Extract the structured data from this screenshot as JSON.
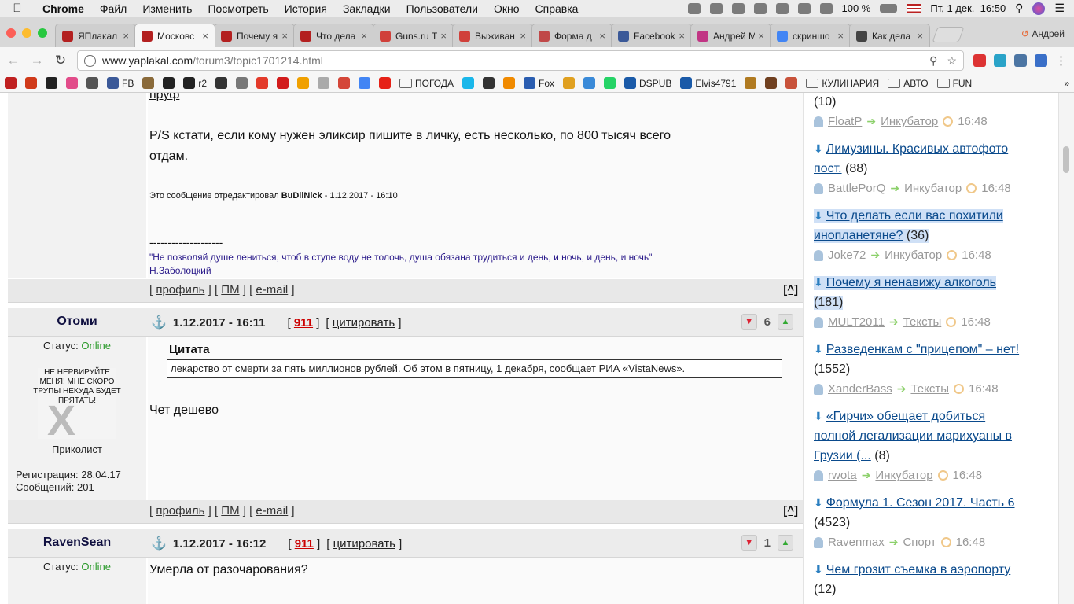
{
  "menubar": {
    "app": "Chrome",
    "items": [
      "Файл",
      "Изменить",
      "Посмотреть",
      "История",
      "Закладки",
      "Пользователи",
      "Окно",
      "Справка"
    ],
    "battery": "100 %",
    "datetime": "Пт, 1 дек.  16:50"
  },
  "tabs": [
    {
      "label": "ЯПлакал",
      "color": "#b32020"
    },
    {
      "label": "Московс",
      "color": "#b32020"
    },
    {
      "label": "Почему я",
      "color": "#b32020"
    },
    {
      "label": "Что дела",
      "color": "#b32020"
    },
    {
      "label": "Guns.ru Т",
      "color": "#d0403a"
    },
    {
      "label": "Выживан",
      "color": "#d0403a"
    },
    {
      "label": "Форма д",
      "color": "#c04848"
    },
    {
      "label": "Facebook",
      "color": "#3b5998"
    },
    {
      "label": "Андрей М",
      "color": "#c13584"
    },
    {
      "label": "скриншо",
      "color": "#4285f4"
    },
    {
      "label": "Как дела",
      "color": "#444444"
    }
  ],
  "active_tab_index": 1,
  "profile_name": "Андрей",
  "url": {
    "host": "www.yaplakal.com",
    "path": "/forum3/topic1701214.html"
  },
  "bookmarks": [
    {
      "label": "",
      "color": "#c02020"
    },
    {
      "label": "",
      "color": "#d03a1a"
    },
    {
      "label": "",
      "color": "#222222"
    },
    {
      "label": "",
      "color": "#e24c8a"
    },
    {
      "label": "",
      "color": "#555555"
    },
    {
      "label": "FB",
      "color": "#3b5998"
    },
    {
      "label": "",
      "color": "#8a6a3a"
    },
    {
      "label": "",
      "color": "#222222"
    },
    {
      "label": "r2",
      "color": "#222222"
    },
    {
      "label": "",
      "color": "#333333"
    },
    {
      "label": "",
      "color": "#777777"
    },
    {
      "label": "",
      "color": "#e33a2a"
    },
    {
      "label": "",
      "color": "#d21b1b"
    },
    {
      "label": "",
      "color": "#f0a000"
    },
    {
      "label": "",
      "color": "#aaaaaa"
    },
    {
      "label": "",
      "color": "#d44638"
    },
    {
      "label": "",
      "color": "#4285f4"
    },
    {
      "label": "",
      "color": "#e62117"
    },
    {
      "label": "ПОГОДА",
      "folder": true
    },
    {
      "label": "",
      "color": "#1ab7ea"
    },
    {
      "label": "",
      "color": "#333333"
    },
    {
      "label": "",
      "color": "#f08a00"
    },
    {
      "label": "Fox",
      "color": "#2a5db0"
    },
    {
      "label": "",
      "color": "#e0a020"
    },
    {
      "label": "",
      "color": "#3a8ad8"
    },
    {
      "label": "",
      "color": "#25d366"
    },
    {
      "label": "DSPUB",
      "color": "#1a5aa8"
    },
    {
      "label": "Elvis4791",
      "color": "#1a5aa8"
    },
    {
      "label": "",
      "color": "#b07a20"
    },
    {
      "label": "",
      "color": "#704020"
    },
    {
      "label": "",
      "color": "#c8523a"
    },
    {
      "label": "КУЛИНАРИЯ",
      "folder": true
    },
    {
      "label": "АВТО",
      "folder": true
    },
    {
      "label": "FUN",
      "folder": true
    }
  ],
  "prev_post": {
    "top_fragment": "пруф",
    "text_line1": "P/S кстати, если кому нужен эликсир пишите в личку, есть несколько, по 800 тысяч всего",
    "text_line2": "отдам.",
    "edited_prefix": "Это сообщение отредактировал ",
    "edited_user": "BuDilNick",
    "edited_suffix": " - 1.12.2017 - 16:10",
    "sig_rule": "--------------------",
    "sig_quote": "\"Не позволяй душе лениться, чтоб в ступе воду не толочь, душа обязана трудиться и день, и ночь, и день, и ночь\"",
    "sig_author": "Н.Заболоцкий"
  },
  "post_links": {
    "profile": "профиль",
    "pm": "ПМ",
    "email": "e-mail",
    "top": "[^]"
  },
  "posts": [
    {
      "author": "Отоми",
      "date": "1.12.2017 - 16:11",
      "num": "911",
      "quote_btn": "цитировать",
      "rating": "6",
      "status_label": "Статус: ",
      "status": "Online",
      "avatar_text": "НЕ НЕРВИРУЙТЕ МЕНЯ! МНЕ СКОРО ТРУПЫ НЕКУДА БУДЕТ ПРЯТАТЬ!",
      "rank": "Приколист",
      "reg_label": "Регистрация: ",
      "reg": "28.04.17",
      "msgs_label": "Сообщений: ",
      "msgs": "201",
      "quote_title": "Цитата",
      "quote_text": "лекарство от смерти за пять миллионов рублей. Об этом в пятницу, 1 декабря, сообщает РИА «VistaNews».",
      "text": "Чет дешево"
    },
    {
      "author": "RavenSean",
      "date": "1.12.2017 - 16:12",
      "num": "911",
      "quote_btn": "цитировать",
      "rating": "1",
      "status_label": "Статус: ",
      "status": "Online",
      "text": "Умерла от разочарования?"
    }
  ],
  "sidebar": {
    "first_count": "(10)",
    "items": [
      {
        "user": "FloatP",
        "cat": "Инкубатор",
        "time": "16:48"
      },
      {
        "title_a": "Лимузины. Красивых автофото",
        "title_b": "пост.",
        "count": "(88)",
        "user": "BattlePorQ",
        "cat": "Инкубатор",
        "time": "16:48"
      },
      {
        "title_a": "Что делать если вас похитили",
        "title_b": "инопланетяне?",
        "count": "(36)",
        "user": "Joke72",
        "cat": "Инкубатор",
        "time": "16:48",
        "highlight": true
      },
      {
        "title_a": "Почему я ненавижу алкоголь",
        "title_b": "",
        "count": "(181)",
        "user": "MULT2011",
        "cat": "Тексты",
        "time": "16:48",
        "highlight": true
      },
      {
        "title_a": "Разведенкам с \"прицепом\" – нет!",
        "title_b": "",
        "count": "(1552)",
        "user": "XanderBass",
        "cat": "Тексты",
        "time": "16:48"
      },
      {
        "title_a": "«Гирчи» обещает добиться",
        "title_b": "полной легализации марихуаны в",
        "title_c": "Грузии (...",
        "count": "(8)",
        "user": "rwota",
        "cat": "Инкубатор",
        "time": "16:48"
      },
      {
        "title_a": "Формула 1. Сезон 2017. Часть 6",
        "title_b": "",
        "count": "(4523)",
        "user": "Ravenmax",
        "cat": "Спорт",
        "time": "16:48"
      },
      {
        "title_a": "Чем грозит съемка в аэропорту",
        "title_b": "",
        "count": "(12)"
      }
    ]
  }
}
